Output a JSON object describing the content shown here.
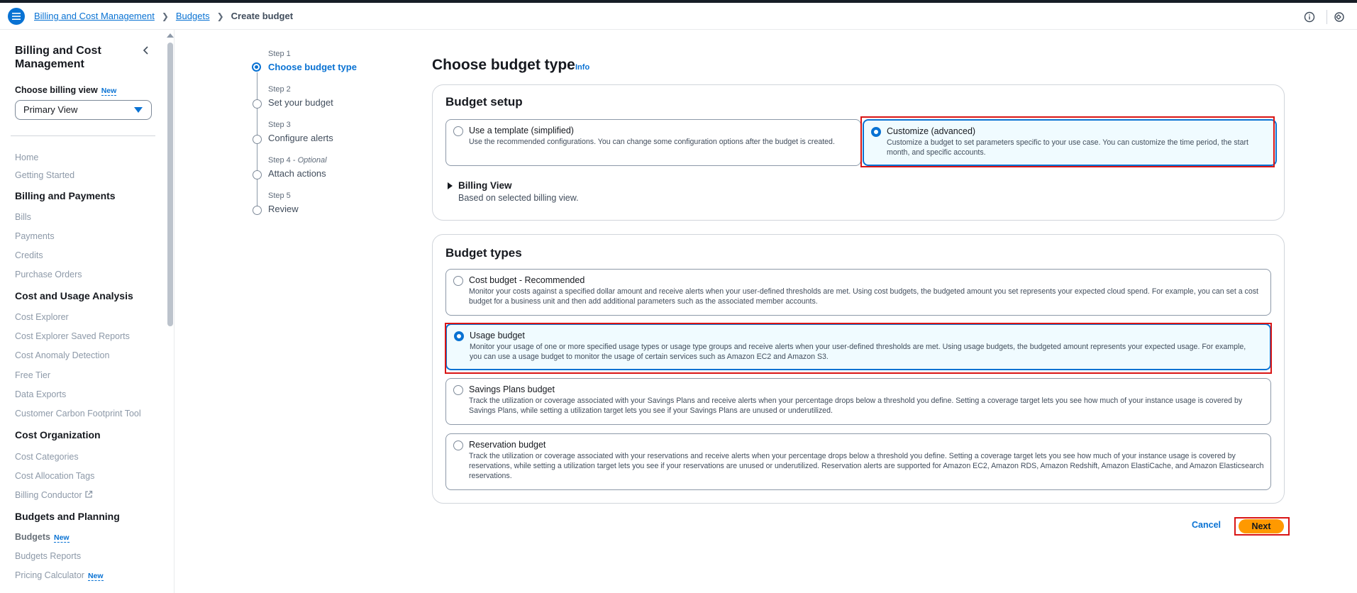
{
  "breadcrumb": {
    "items": [
      "Billing and Cost Management",
      "Budgets"
    ],
    "current": "Create budget"
  },
  "sidebar": {
    "title": "Billing and Cost Management",
    "view_label": "Choose billing view",
    "view_badge": "New",
    "view_value": "Primary View",
    "links_top": [
      "Home",
      "Getting Started"
    ],
    "sections": [
      {
        "heading": "Billing and Payments",
        "items": [
          "Bills",
          "Payments",
          "Credits",
          "Purchase Orders"
        ]
      },
      {
        "heading": "Cost and Usage Analysis",
        "items": [
          "Cost Explorer",
          "Cost Explorer Saved Reports",
          "Cost Anomaly Detection",
          "Free Tier",
          "Data Exports",
          "Customer Carbon Footprint Tool"
        ]
      },
      {
        "heading": "Cost Organization",
        "items": [
          "Cost Categories",
          "Cost Allocation Tags",
          "Billing Conductor"
        ]
      },
      {
        "heading": "Budgets and Planning",
        "items": [
          "Budgets",
          "Budgets Reports",
          "Pricing Calculator"
        ]
      }
    ],
    "budgets_badge": "New",
    "pricing_badge": "New"
  },
  "steps": [
    {
      "num": "Step 1",
      "label": "Choose budget type"
    },
    {
      "num": "Step 2",
      "label": "Set your budget"
    },
    {
      "num": "Step 3",
      "label": "Configure alerts"
    },
    {
      "num": "Step 4",
      "optional": "Optional",
      "label": "Attach actions"
    },
    {
      "num": "Step 5",
      "label": "Review"
    }
  ],
  "main": {
    "title": "Choose budget type",
    "info": "Info",
    "setup": {
      "title": "Budget setup",
      "options": [
        {
          "title": "Use a template (simplified)",
          "desc": "Use the recommended configurations. You can change some configuration options after the budget is created."
        },
        {
          "title": "Customize (advanced)",
          "desc": "Customize a budget to set parameters specific to your use case. You can customize the time period, the start month, and specific accounts."
        }
      ],
      "billing_view_title": "Billing View",
      "billing_view_desc": "Based on selected billing view."
    },
    "types": {
      "title": "Budget types",
      "options": [
        {
          "title": "Cost budget - Recommended",
          "desc": "Monitor your costs against a specified dollar amount and receive alerts when your user-defined thresholds are met. Using cost budgets, the budgeted amount you set represents your expected cloud spend. For example, you can set a cost budget for a business unit and then add additional parameters such as the associated member accounts."
        },
        {
          "title": "Usage budget",
          "desc": "Monitor your usage of one or more specified usage types or usage type groups and receive alerts when your user-defined thresholds are met. Using usage budgets, the budgeted amount represents your expected usage. For example, you can use a usage budget to monitor the usage of certain services such as Amazon EC2 and Amazon S3."
        },
        {
          "title": "Savings Plans budget",
          "desc": "Track the utilization or coverage associated with your Savings Plans and receive alerts when your percentage drops below a threshold you define. Setting a coverage target lets you see how much of your instance usage is covered by Savings Plans, while setting a utilization target lets you see if your Savings Plans are unused or underutilized."
        },
        {
          "title": "Reservation budget",
          "desc": "Track the utilization or coverage associated with your reservations and receive alerts when your percentage drops below a threshold you define. Setting a coverage target lets you see how much of your instance usage is covered by reservations, while setting a utilization target lets you see if your reservations are unused or underutilized. Reservation alerts are supported for Amazon EC2, Amazon RDS, Amazon Redshift, Amazon ElastiCache, and Amazon Elasticsearch reservations."
        }
      ]
    },
    "cancel_label": "Cancel",
    "next_label": "Next"
  },
  "colors": {
    "accent": "#0972d3",
    "primary_button": "#ff9900",
    "highlight": "#d91515"
  }
}
